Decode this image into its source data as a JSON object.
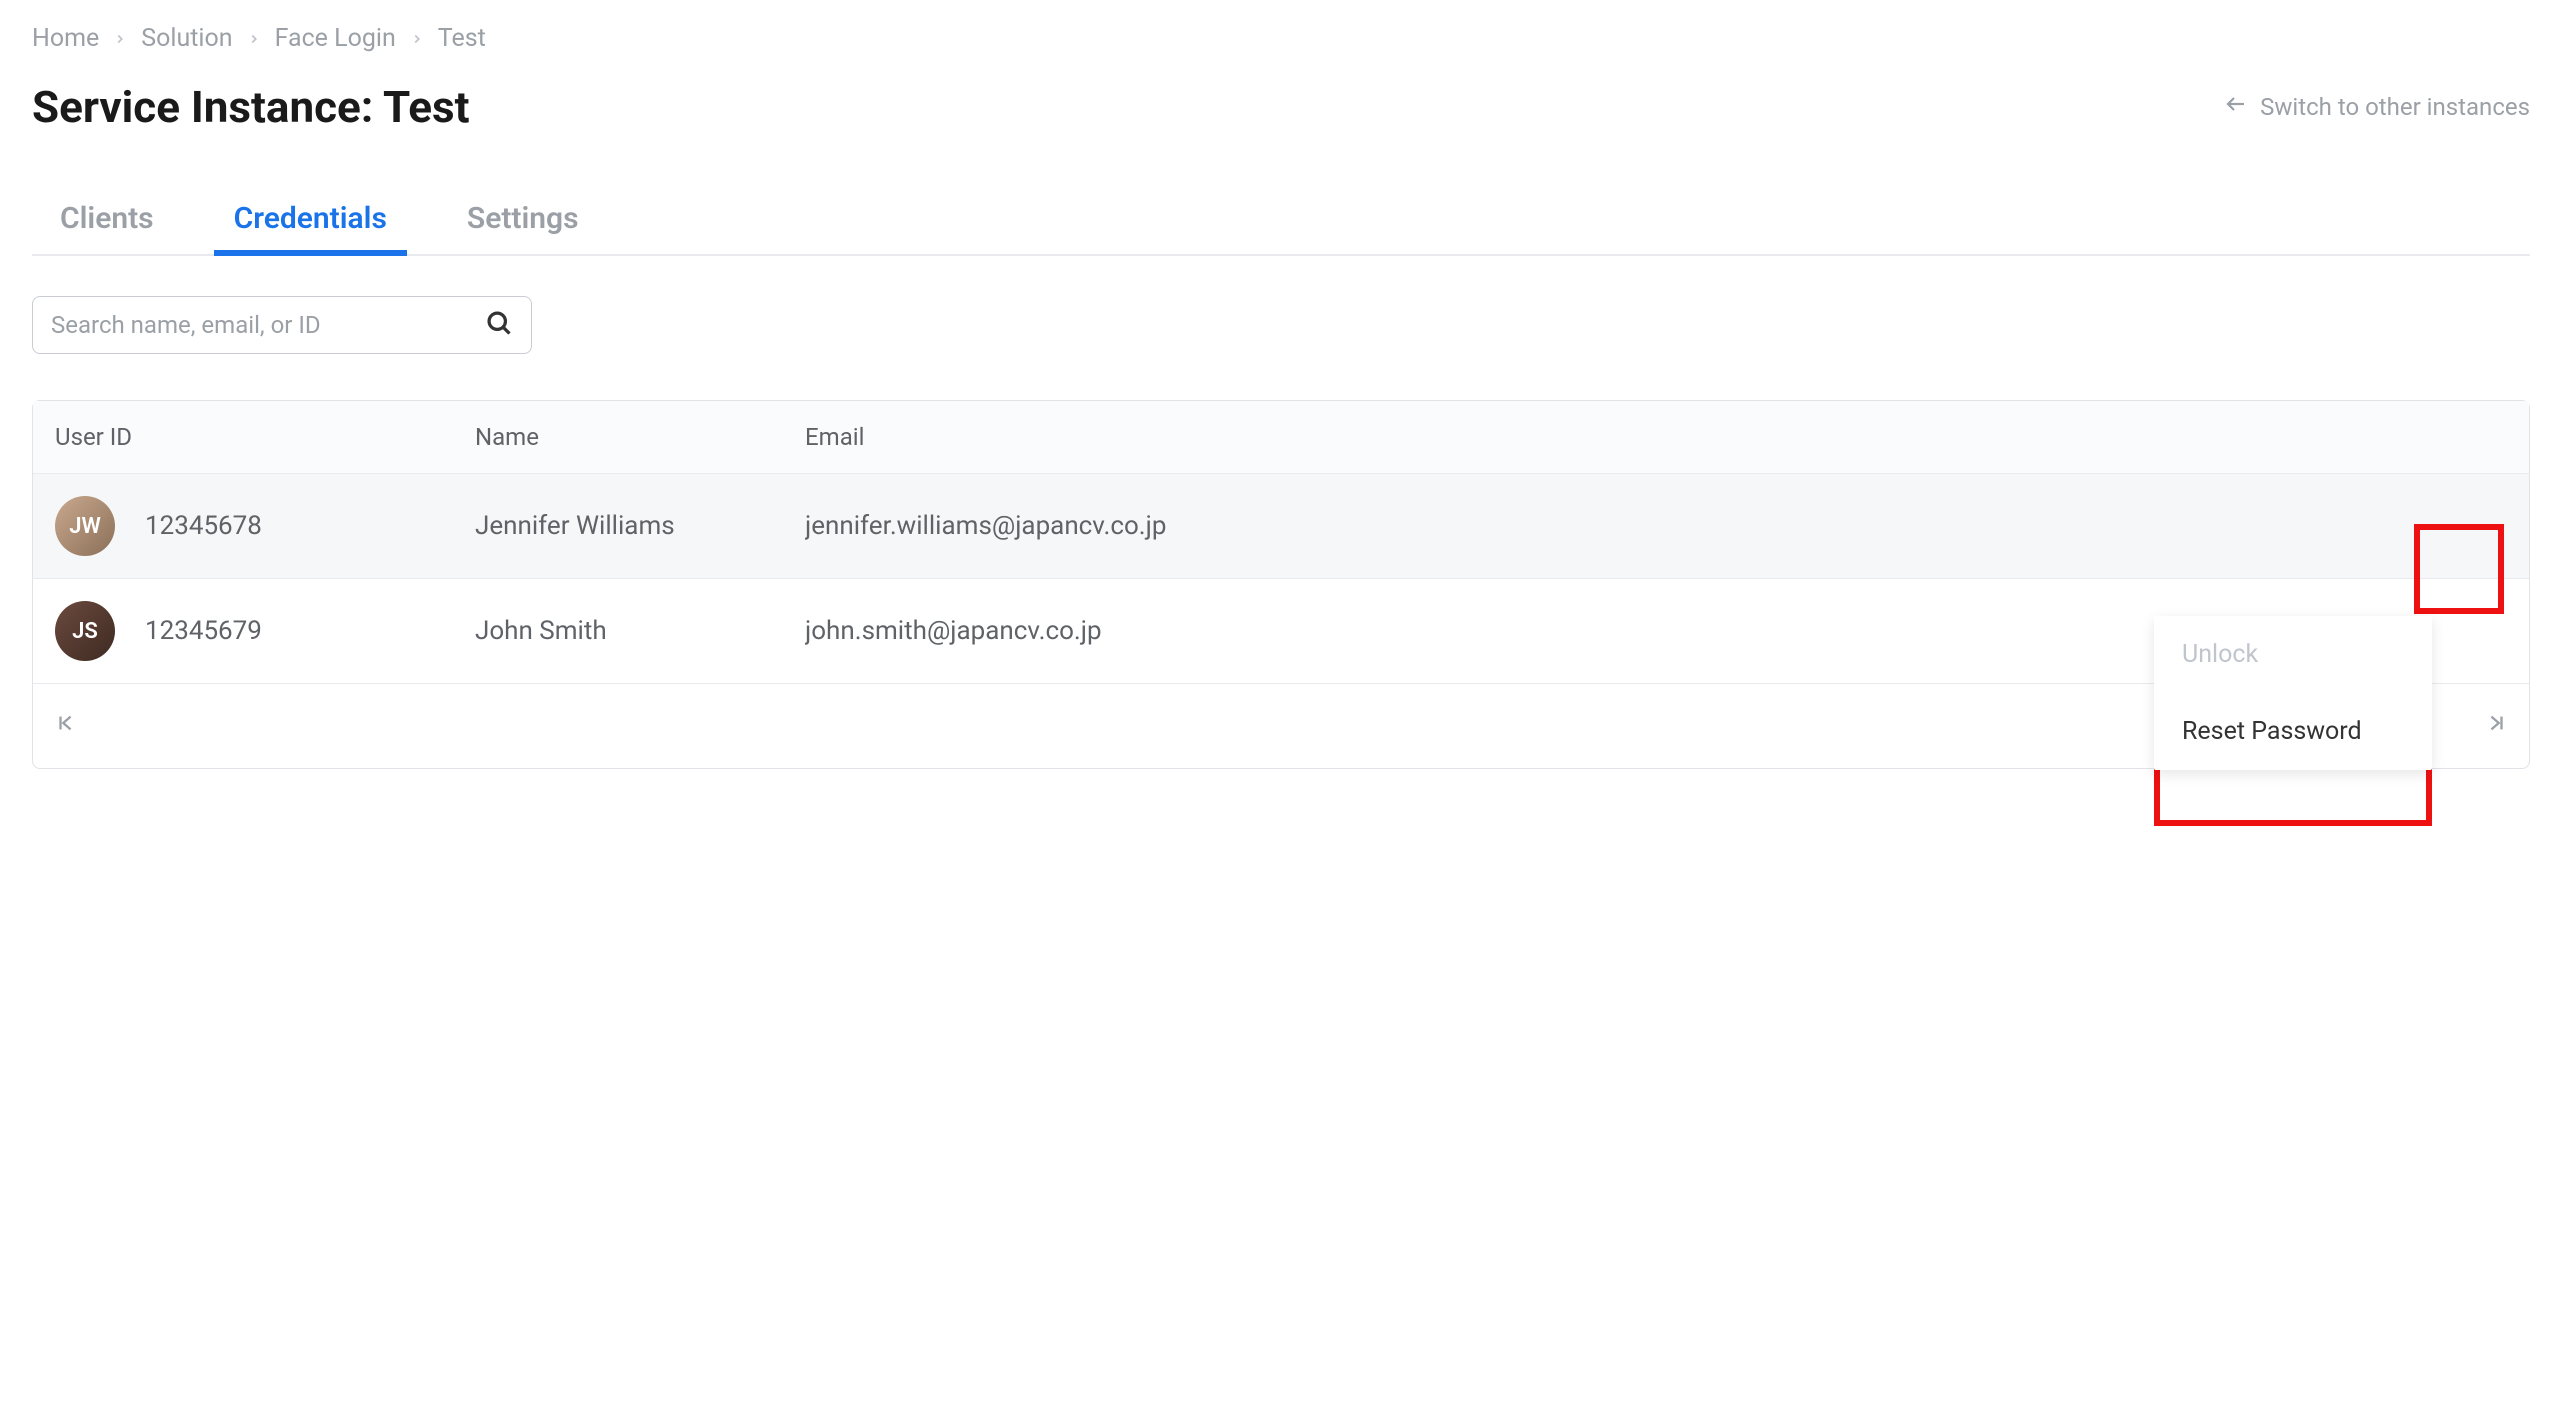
{
  "breadcrumb": {
    "items": [
      "Home",
      "Solution",
      "Face Login",
      "Test"
    ]
  },
  "header": {
    "title": "Service Instance: Test",
    "switch_label": "Switch to other instances"
  },
  "tabs": {
    "items": [
      "Clients",
      "Credentials",
      "Settings"
    ],
    "active_index": 1
  },
  "search": {
    "placeholder": "Search name, email, or ID"
  },
  "table": {
    "columns": [
      "User ID",
      "Name",
      "Email"
    ],
    "rows": [
      {
        "user_id": "12345678",
        "name": "Jennifer Williams",
        "email": "jennifer.williams@japancv.co.jp",
        "initials": "JW"
      },
      {
        "user_id": "12345679",
        "name": "John Smith",
        "email": "john.smith@japancv.co.jp",
        "initials": "JS"
      }
    ]
  },
  "row_menu": {
    "items": [
      {
        "label": "Unlock",
        "disabled": true
      },
      {
        "label": "Reset Password",
        "disabled": false
      }
    ]
  }
}
